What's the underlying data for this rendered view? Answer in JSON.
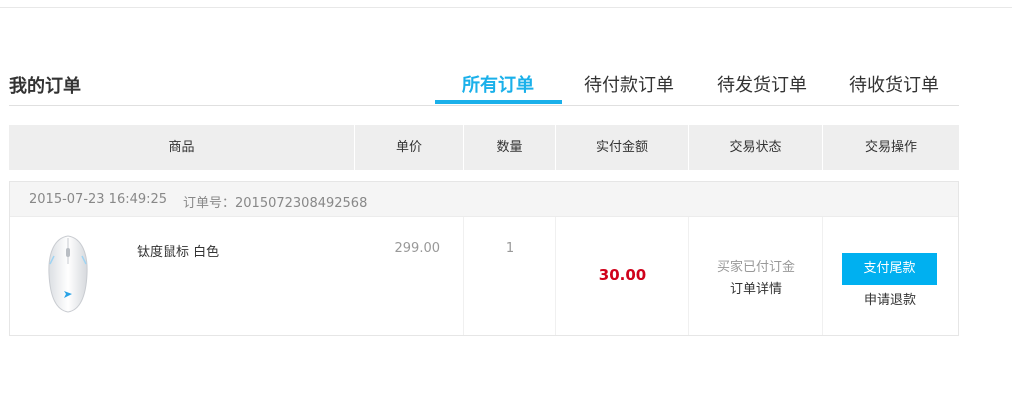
{
  "header": {
    "title": "我的订单",
    "tabs": [
      {
        "label": "所有订单",
        "active": true
      },
      {
        "label": "待付款订单",
        "active": false
      },
      {
        "label": "待发货订单",
        "active": false
      },
      {
        "label": "待收货订单",
        "active": false
      }
    ]
  },
  "table": {
    "columns": [
      "商品",
      "单价",
      "数量",
      "实付金额",
      "交易状态",
      "交易操作"
    ]
  },
  "order": {
    "timestamp": "2015-07-23 16:49:25",
    "order_no": "订单号：2015072308492568",
    "product": {
      "name": "钛度鼠标 白色",
      "image_icon": "mouse-product-image"
    },
    "unit_price": "299.00",
    "quantity": "1",
    "paid_amount": "30.00",
    "status": "买家已付订金",
    "detail_link": "订单详情",
    "pay_button": "支付尾款",
    "refund_link": "申请退款"
  },
  "colors": {
    "accent": "#1ab0ea",
    "button": "#00b0f0",
    "price_red": "#d0021b"
  }
}
